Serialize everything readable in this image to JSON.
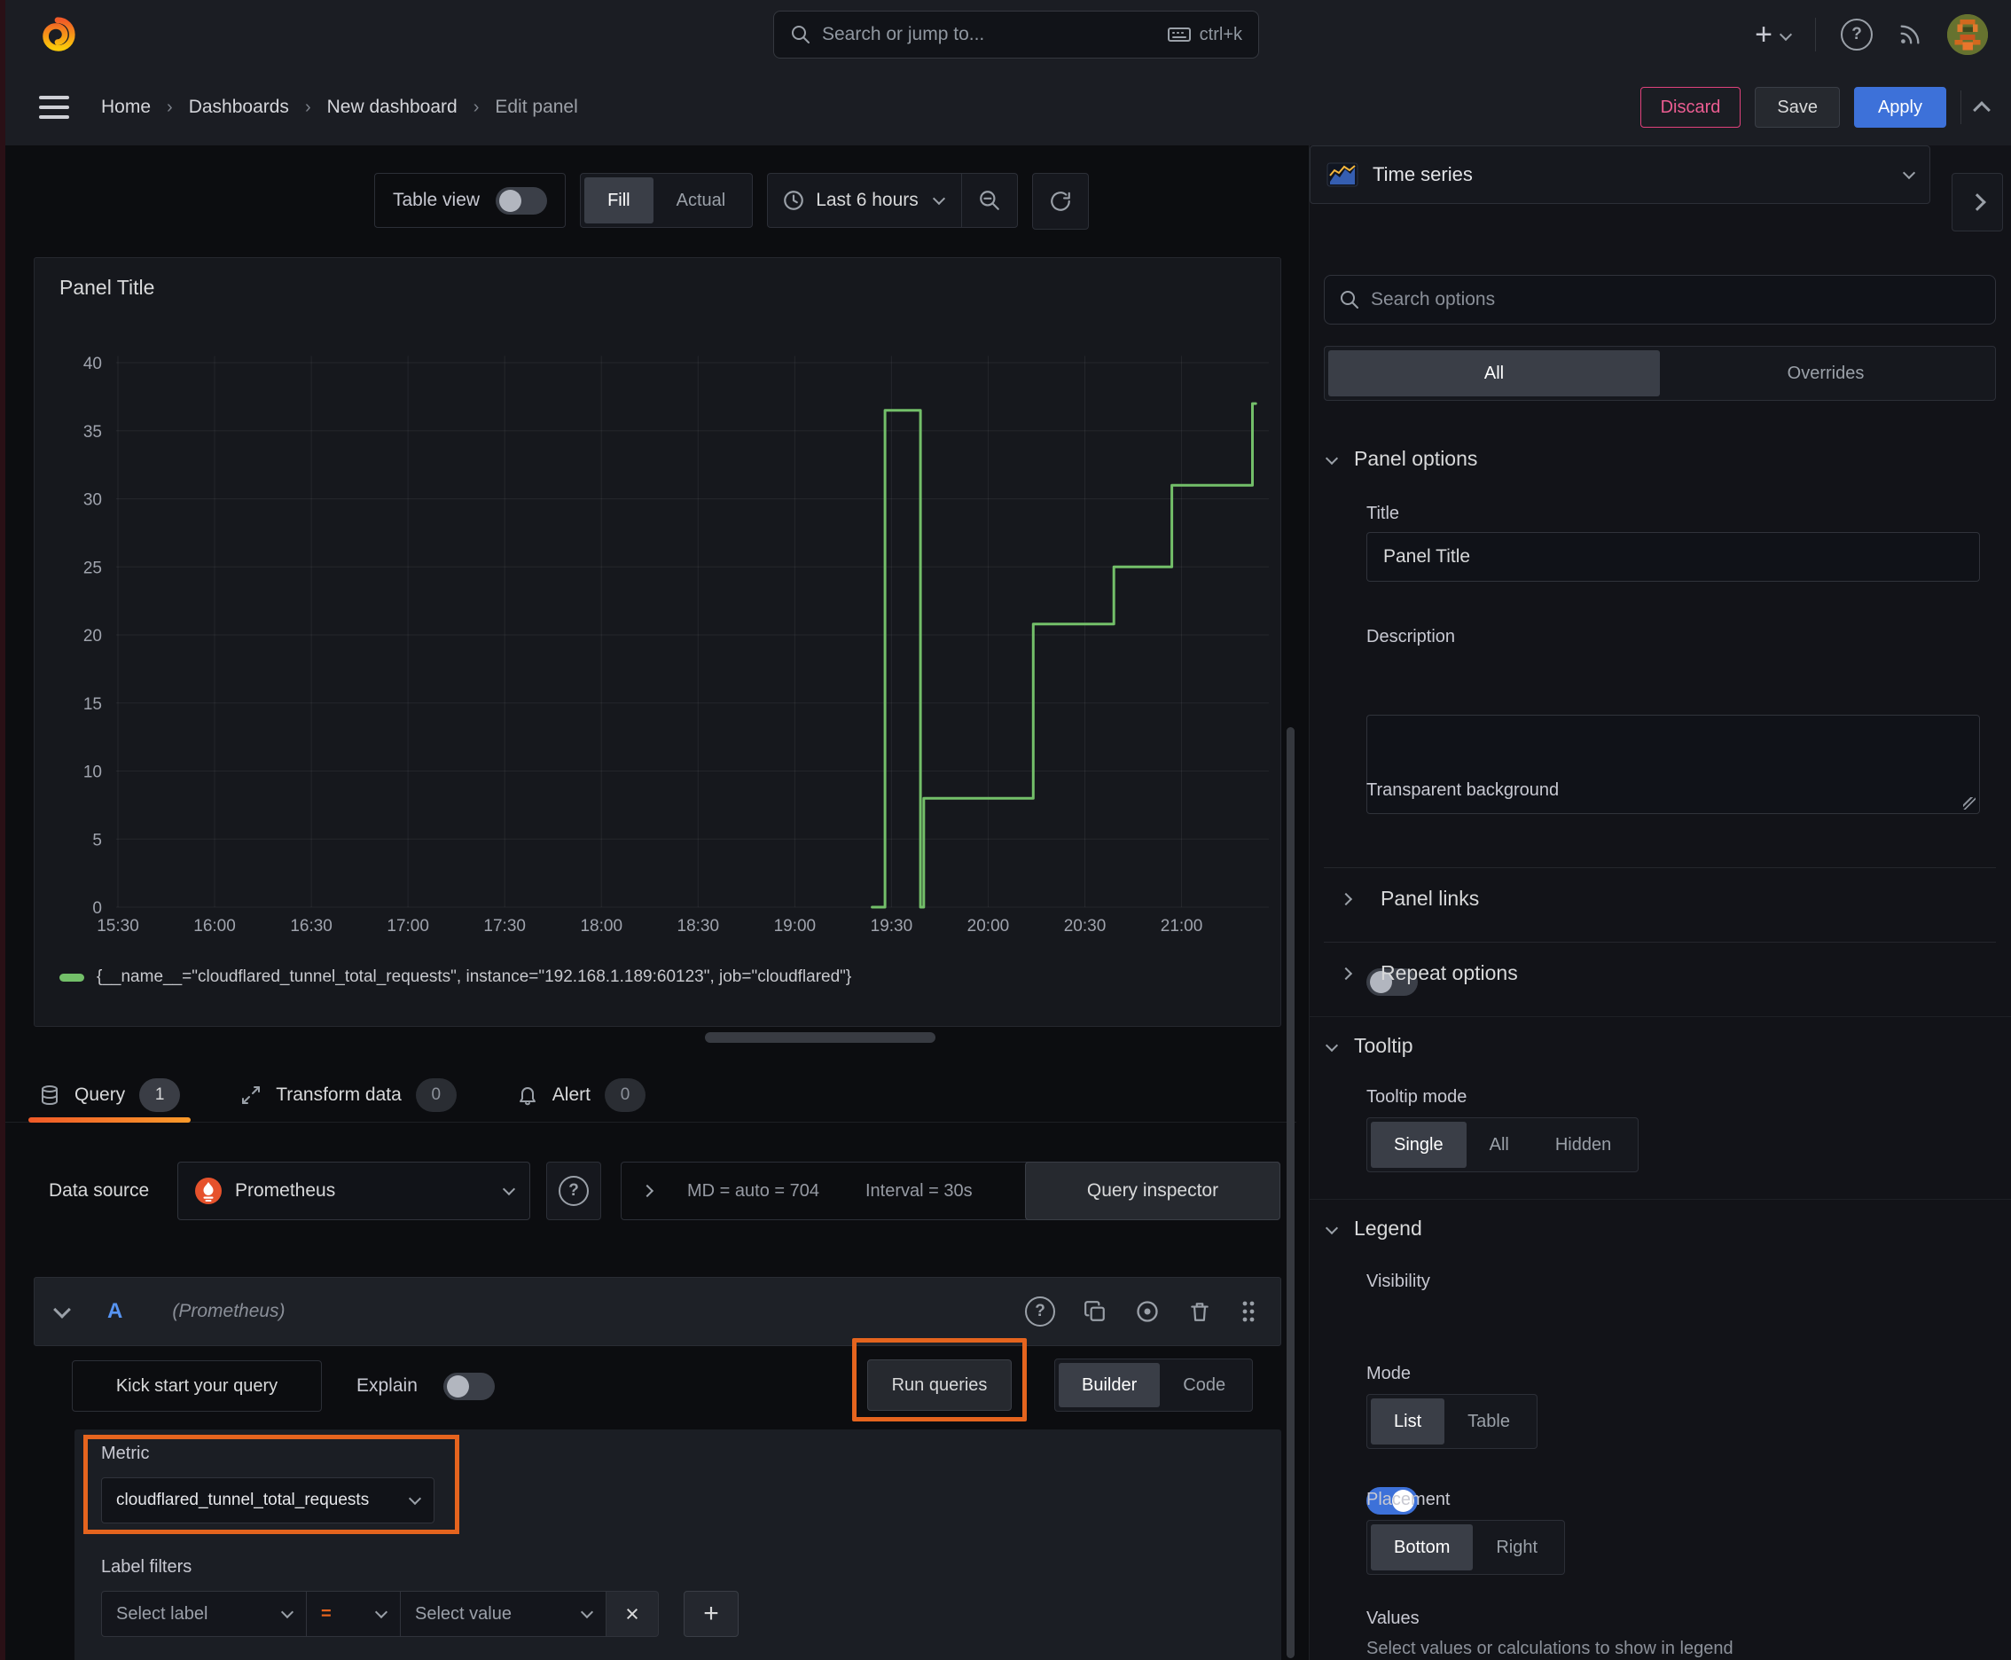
{
  "topbar": {
    "search_placeholder": "Search or jump to...",
    "shortcut": "ctrl+k"
  },
  "breadcrumb": {
    "items": [
      "Home",
      "Dashboards",
      "New dashboard",
      "Edit panel"
    ]
  },
  "actions": {
    "discard": "Discard",
    "save": "Save",
    "apply": "Apply"
  },
  "view_toolbar": {
    "table_view_label": "Table view",
    "fill_actual": {
      "options": [
        "Fill",
        "Actual"
      ],
      "active": 0
    },
    "time_range": "Last 6 hours"
  },
  "panel": {
    "title": "Panel Title"
  },
  "chart_data": {
    "type": "line",
    "title": "Panel Title",
    "x_note": "x encoded as minutes after 15:30; step-after line of Prometheus counter",
    "x_tick_labels": [
      "15:30",
      "16:00",
      "16:30",
      "17:00",
      "17:30",
      "18:00",
      "18:30",
      "19:00",
      "19:30",
      "20:00",
      "20:30",
      "21:00"
    ],
    "x_tick_minutes": [
      0,
      30,
      60,
      90,
      120,
      150,
      180,
      210,
      240,
      270,
      300,
      330
    ],
    "y_ticks": [
      0,
      5,
      10,
      15,
      20,
      25,
      30,
      35,
      40
    ],
    "ylim": [
      0,
      40.5
    ],
    "xlim_minutes": [
      -11,
      357
    ],
    "grid": true,
    "legend_position": "bottom",
    "series": [
      {
        "name": "{__name__=\"cloudflared_tunnel_total_requests\", instance=\"192.168.1.189:60123\", job=\"cloudflared\"}",
        "color": "#73bf69",
        "points_min_val": [
          [
            234,
            0
          ],
          [
            238,
            0
          ],
          [
            238,
            36.5
          ],
          [
            249,
            36.5
          ],
          [
            249,
            0
          ],
          [
            250,
            0
          ],
          [
            250,
            8
          ],
          [
            284,
            8
          ],
          [
            284,
            20.8
          ],
          [
            309,
            20.8
          ],
          [
            309,
            25
          ],
          [
            327,
            25
          ],
          [
            327,
            31
          ],
          [
            352,
            31
          ],
          [
            352,
            37
          ],
          [
            353,
            37
          ]
        ]
      }
    ]
  },
  "tabs": [
    {
      "label": "Query",
      "count": "1"
    },
    {
      "label": "Transform data",
      "count": "0"
    },
    {
      "label": "Alert",
      "count": "0"
    }
  ],
  "datasource": {
    "label": "Data source",
    "value": "Prometheus",
    "max_data_points": "MD = auto = 704",
    "interval": "Interval = 30s",
    "inspector_label": "Query inspector"
  },
  "query": {
    "ref_id": "A",
    "ds_hint": "(Prometheus)",
    "kick_start": "Kick start your query",
    "explain_label": "Explain",
    "run_label": "Run queries",
    "builder_code": {
      "options": [
        "Builder",
        "Code"
      ],
      "active": 0
    },
    "metric_label": "Metric",
    "metric_value": "cloudflared_tunnel_total_requests",
    "label_filters_label": "Label filters",
    "select_label_placeholder": "Select label",
    "operator": "=",
    "select_value_placeholder": "Select value"
  },
  "options_pane": {
    "viz_name": "Time series",
    "search_placeholder": "Search options",
    "filter_tabs": {
      "options": [
        "All",
        "Overrides"
      ],
      "active": 0
    },
    "panel_options": {
      "heading": "Panel options",
      "title_label": "Title",
      "title_value": "Panel Title",
      "description_label": "Description",
      "description_value": "",
      "transparent_label": "Transparent background",
      "transparent_on": false
    },
    "panel_links_heading": "Panel links",
    "repeat_heading": "Repeat options",
    "tooltip": {
      "heading": "Tooltip",
      "mode_label": "Tooltip mode",
      "modes": {
        "options": [
          "Single",
          "All",
          "Hidden"
        ],
        "active": 0
      }
    },
    "legend": {
      "heading": "Legend",
      "visibility_label": "Visibility",
      "visibility_on": true,
      "mode_label": "Mode",
      "mode": {
        "options": [
          "List",
          "Table"
        ],
        "active": 0
      },
      "placement_label": "Placement",
      "placement": {
        "options": [
          "Bottom",
          "Right"
        ],
        "active": 0
      },
      "values_label": "Values",
      "values_hint": "Select values or calculations to show in legend"
    }
  },
  "colors": {
    "green": "#73bf69",
    "blue": "#3d71d9",
    "orange_highlight": "#e5641e",
    "discard_pink": "#e0427c",
    "tab_gradient_start": "#f05a28",
    "tab_gradient_end": "#fb9a2a"
  }
}
